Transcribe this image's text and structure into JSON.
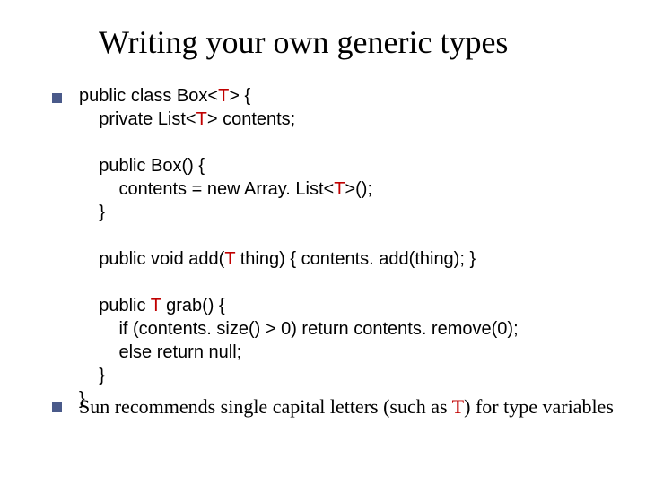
{
  "title": {
    "lead": "Writing ",
    "yo": "yo",
    "rest": "ur own generic types"
  },
  "code": {
    "l1a": "public class Box<",
    "l1b": "T",
    "l1c": "> {",
    "l2a": "    private List<",
    "l2b": "T",
    "l2c": "> contents;",
    "l3": "    public Box() {",
    "l4a": "        contents = new Array. List<",
    "l4b": "T",
    "l4c": ">();",
    "l5": "    }",
    "l6a": "    public void add(",
    "l6b": "T",
    "l6c": " thing) { contents. add(thing); }",
    "l7a": "    public ",
    "l7b": "T",
    "l7c": " grab() {",
    "l8": "        if (contents. size() > 0) return contents. remove(0);",
    "l9": "        else return null;",
    "l10": "    }",
    "l11": "}"
  },
  "footer": {
    "pre": "Sun recommends single capital letters (such as ",
    "tvar": "T",
    "post": ") for type variables"
  }
}
